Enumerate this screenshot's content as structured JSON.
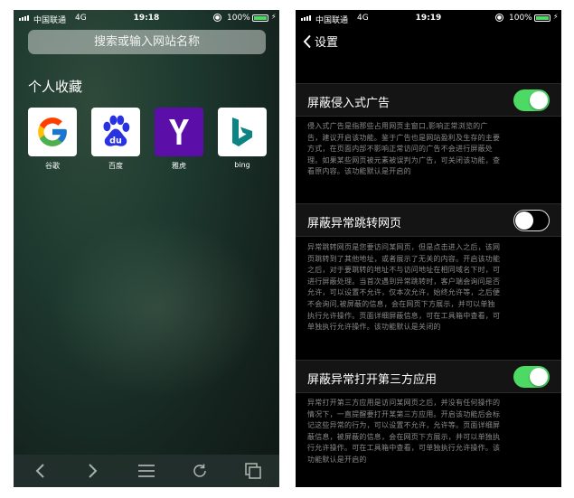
{
  "left_screen": {
    "status_bar": {
      "carrier": "中国联通",
      "network": "4G",
      "time": "19:18",
      "battery": "100%"
    },
    "search": {
      "placeholder": "搜索或输入网站名称"
    },
    "favorites": {
      "title": "个人收藏",
      "items": [
        {
          "label": "谷歌",
          "icon": "google-icon"
        },
        {
          "label": "百度",
          "icon": "baidu-icon"
        },
        {
          "label": "雅虎",
          "icon": "yahoo-icon"
        },
        {
          "label": "bing",
          "icon": "bing-icon"
        }
      ]
    },
    "toolbar": [
      "back-icon",
      "forward-icon",
      "menu-icon",
      "refresh-icon",
      "tabs-icon"
    ]
  },
  "right_screen": {
    "status_bar": {
      "carrier": "中国联通",
      "network": "4G",
      "time": "19:19",
      "battery": "100%"
    },
    "nav": {
      "back_label": "设置"
    },
    "settings": [
      {
        "label": "屏蔽侵入式广告",
        "enabled": true,
        "lines": [
          "侵入式广告是指那些占用网页主窗口,影响正常浏览的广",
          "告，建议开启该功能。鉴于广告也是网站盈利及生存的主要",
          "方式，在页面内部不影响正常访问的广告不会进行屏蔽处",
          "理。如果某些网页被元素被误判为广告，可关闭该功能，查",
          "看原内容。该功能默认是开启的"
        ]
      },
      {
        "label": "屏蔽异常跳转网页",
        "enabled": false,
        "lines": [
          "异常跳转网页是您要访问某网页，但是点击进入之后，该网",
          "页跳转到了其他地址，或者展示了无关的内容。开启该功能",
          "之后，对于要跳转的地址不与访问地址在相同域名下时，可",
          "进行屏蔽处理。当首次遇到异常跳转时，客户端会询问是否",
          "允许，可以设置不允许，仅本次允许，始终允许等，之后便",
          "不会询问,被屏蔽的信息，会在网页下方展示，并可以单独",
          "执行允许操作。页面详细屏蔽信息，可在工具箱中查看，可",
          "单独执行允许操作。该功能默认是关闭的"
        ]
      },
      {
        "label": "屏蔽异常打开第三方应用",
        "enabled": true,
        "lines": [
          "异常打开第三方应用是访问某网页之后，并没有任何操作的",
          "情况下，一直提醒要打开某第三方应用。开启该功能后会标",
          "记这些异常的行为，可以设置不允许，允许等。页面详细屏",
          "蔽信息，被屏蔽的信息，会在网页下方展示，并可以单独执",
          "行允许操作。可在工具箱中查看，可单独执行允许操作。该",
          "功能默认是开启的"
        ]
      }
    ]
  }
}
